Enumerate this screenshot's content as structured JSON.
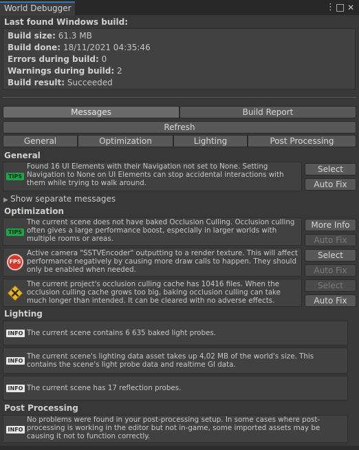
{
  "window": {
    "title": "World Debugger",
    "menu_icon": "⋮",
    "maximize_icon": "□",
    "close_icon": "✕"
  },
  "build": {
    "heading": "Last found Windows build:",
    "rows": [
      {
        "label": "Build size:",
        "value": "61.3 MB"
      },
      {
        "label": "Build done:",
        "value": "18/11/2021 04:35:46"
      },
      {
        "label": "Errors during build:",
        "value": "0"
      },
      {
        "label": "Warnings during build:",
        "value": "2"
      },
      {
        "label": "Build result:",
        "value": "Succeeded"
      }
    ]
  },
  "tabs": {
    "messages": "Messages",
    "build_report": "Build Report"
  },
  "refresh": "Refresh",
  "filters": [
    "General",
    "Optimization",
    "Lighting",
    "Post Processing"
  ],
  "sections": {
    "general": "General",
    "optimization": "Optimization",
    "lighting": "Lighting",
    "post": "Post Processing"
  },
  "show_separate": "Show separate messages",
  "general_msg": {
    "icon_label": "TIPS",
    "text": "Found 16 UI Elements with their Navigation not set to None. Setting Navigation to None on UI Elements can stop accidental interactions with them while trying to walk around.",
    "select": "Select",
    "autofix": "Auto Fix"
  },
  "opt_msgs": [
    {
      "icon_label": "TIPS",
      "text": "The current scene does not have baked Occlusion Culling. Occlusion culling often gives a large performance boost, especially in larger worlds with multiple rooms or areas.",
      "btn1": "More Info",
      "btn2": "Auto Fix"
    },
    {
      "icon_label": "FPS",
      "text": "Active camera \"SSTVEncoder\" outputting to a render texture. This will affect performance negatively by causing more draw calls to happen. They should only be enabled when needed.",
      "btn1": "Select",
      "btn2": "Auto Fix"
    },
    {
      "icon_label": "",
      "text": "The current project's occlusion culling cache has 10416 files. When the occlusion culling cache grows too big, baking occlusion culling can take much longer than intended. It can be cleared with no adverse effects.",
      "btn1": "Select",
      "btn2": "Auto Fix"
    }
  ],
  "lighting_msgs": [
    {
      "icon_label": "INFO",
      "text": "The current scene contains 6 635 baked light probes."
    },
    {
      "icon_label": "INFO",
      "text": "The current scene's lighting data asset takes up 4,02 MB of the world's size. This contains the scene's light probe data and realtime GI data."
    },
    {
      "icon_label": "INFO",
      "text": "The current scene has 17 reflection probes."
    }
  ],
  "post_msg": {
    "icon_label": "INFO",
    "text": "No problems were found in your post-processing setup. In some cases where post-processing is working in the editor but not in-game, some imported assets may be causing it not to function correctly."
  },
  "colors": {
    "tips": "#1fa34a",
    "fps": "#d03a2a",
    "warn": "#e2b52a",
    "accent": "#3a79bb"
  }
}
